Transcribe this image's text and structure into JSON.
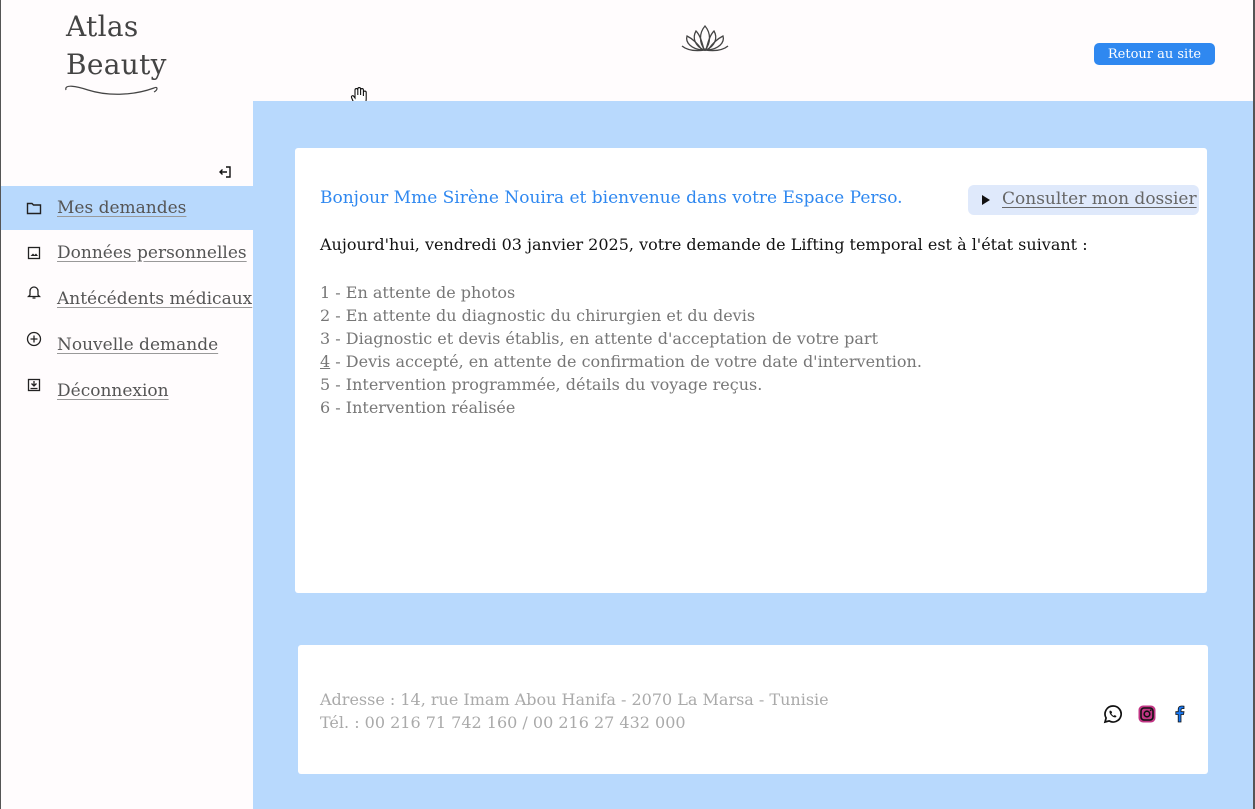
{
  "brand": {
    "line1": "Atlas",
    "line2": "Beauty",
    "logo_icon": "lotus-icon"
  },
  "header": {
    "back_button": "Retour au site"
  },
  "sidebar": {
    "collapse_icon": "collapse-sidebar-icon",
    "items": [
      {
        "label": "Mes demandes",
        "icon": "folder-icon",
        "active": true
      },
      {
        "label": "Données personnelles",
        "icon": "image-icon",
        "active": false
      },
      {
        "label": "Antécédents médicaux",
        "icon": "bell-icon",
        "active": false
      },
      {
        "label": "Nouvelle demande",
        "icon": "plus-circle-icon",
        "active": false
      },
      {
        "label": "Déconnexion",
        "icon": "logout-icon",
        "active": false
      }
    ]
  },
  "main": {
    "greeting": "Bonjour Mme Sirène Nouira et bienvenue dans votre Espace Perso.",
    "dossier_button": "Consulter mon dossier",
    "status_intro": "Aujourd'hui, vendredi 03 janvier 2025, votre demande de Lifting temporal est à l'état suivant :",
    "current_step": 4,
    "steps": [
      {
        "num": "1",
        "text": " - En attente de photos"
      },
      {
        "num": "2",
        "text": " - En attente du diagnostic du chirurgien et du devis"
      },
      {
        "num": "3",
        "text": " - Diagnostic et devis établis, en attente d'acceptation de votre part"
      },
      {
        "num": "4",
        "text": " - Devis accepté, en attente de confirmation de votre date d'intervention."
      },
      {
        "num": "5",
        "text": " - Intervention programmée, détails du voyage reçus."
      },
      {
        "num": "6",
        "text": " - Intervention réalisée"
      }
    ]
  },
  "footer": {
    "address": "Adresse : 14, rue Imam Abou Hanifa - 2070 La Marsa - Tunisie",
    "phone": "Tél. : 00 216 71 742 160 / 00 216 27 432 000",
    "social": [
      "whatsapp-icon",
      "instagram-icon",
      "facebook-icon"
    ]
  },
  "colors": {
    "accent": "#2f88f0",
    "panel_bg": "#b8d9fd",
    "instagram": "#c13584"
  }
}
